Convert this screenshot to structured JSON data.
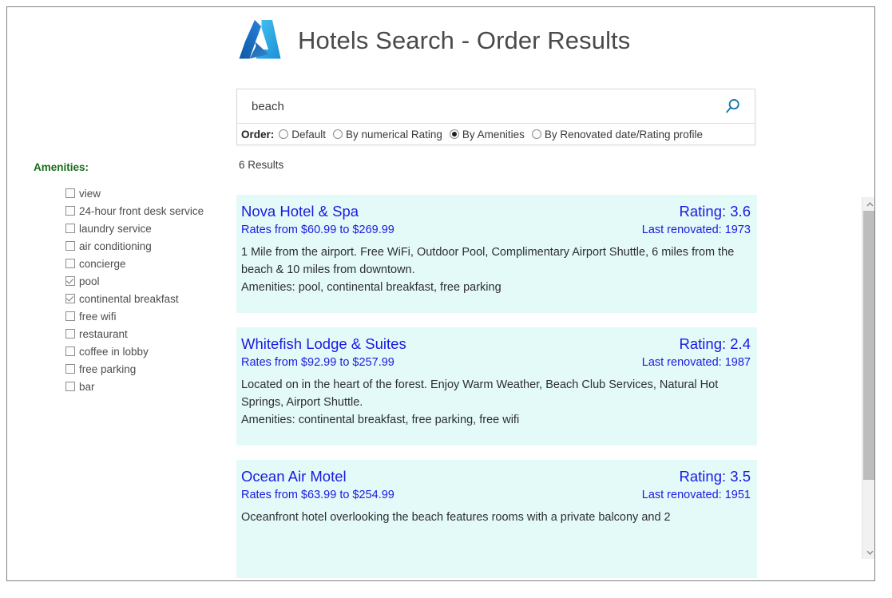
{
  "header": {
    "logo_icon": "azure-logo-icon",
    "title": "Hotels Search - Order Results"
  },
  "search": {
    "query": "beach",
    "placeholder": "",
    "search_icon": "search-icon",
    "order_label": "Order:",
    "order_options": [
      {
        "label": "Default",
        "selected": false
      },
      {
        "label": "By numerical Rating",
        "selected": false
      },
      {
        "label": "By Amenities",
        "selected": true
      },
      {
        "label": "By Renovated date/Rating profile",
        "selected": false
      }
    ]
  },
  "amenities_filter": {
    "heading": "Amenities:",
    "heading_color": "#1a6b1a",
    "items": [
      {
        "label": "view",
        "checked": false
      },
      {
        "label": "24-hour front desk service",
        "checked": false
      },
      {
        "label": "laundry service",
        "checked": false
      },
      {
        "label": "air conditioning",
        "checked": false
      },
      {
        "label": "concierge",
        "checked": false
      },
      {
        "label": "pool",
        "checked": true
      },
      {
        "label": "continental breakfast",
        "checked": true
      },
      {
        "label": "free wifi",
        "checked": false
      },
      {
        "label": "restaurant",
        "checked": false
      },
      {
        "label": "coffee in lobby",
        "checked": false
      },
      {
        "label": "free parking",
        "checked": false
      },
      {
        "label": "bar",
        "checked": false
      }
    ]
  },
  "results": {
    "count_text": "6 Results",
    "card_background": "#e3faf9",
    "link_color": "#1a1ae0",
    "items": [
      {
        "name": "Nova Hotel & Spa",
        "rating": "Rating: 3.6",
        "rates": "Rates from $60.99 to $269.99",
        "renovated": "Last renovated: 1973",
        "description": "1 Mile from the airport.  Free WiFi, Outdoor Pool, Complimentary Airport Shuttle, 6 miles from the beach & 10 miles from downtown.",
        "amenities": "Amenities: pool, continental breakfast, free parking"
      },
      {
        "name": "Whitefish Lodge & Suites",
        "rating": "Rating: 2.4",
        "rates": "Rates from $92.99 to $257.99",
        "renovated": "Last renovated: 1987",
        "description": "Located on in the heart of the forest. Enjoy Warm Weather, Beach Club Services, Natural Hot Springs, Airport Shuttle.",
        "amenities": "Amenities: continental breakfast, free parking, free wifi"
      },
      {
        "name": "Ocean Air Motel",
        "rating": "Rating: 3.5",
        "rates": "Rates from $63.99 to $254.99",
        "renovated": "Last renovated: 1951",
        "description": "Oceanfront hotel overlooking the beach features rooms with a private balcony and 2",
        "amenities": ""
      }
    ]
  },
  "scrollbar": {
    "up_icon": "chevron-up-icon",
    "down_icon": "chevron-down-icon"
  }
}
